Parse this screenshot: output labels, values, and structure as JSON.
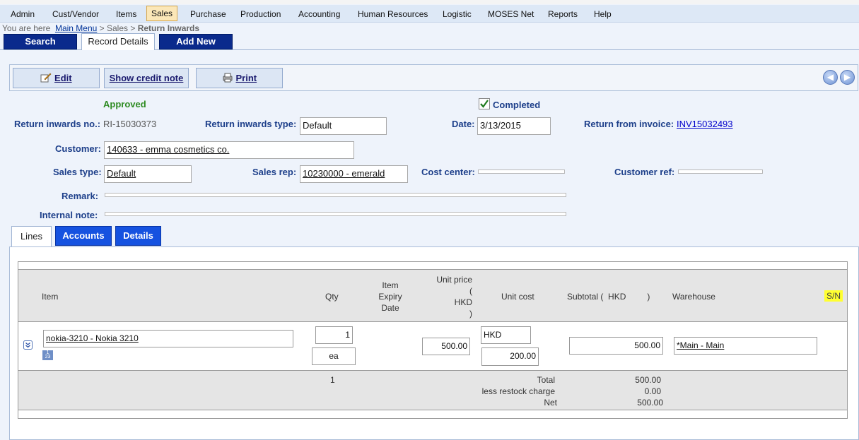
{
  "menu": [
    "Admin",
    "Cust/Vendor",
    "Items",
    "Sales",
    "Purchase",
    "Production",
    "Accounting",
    "Human Resources",
    "Logistic",
    "MOSES Net",
    "Reports",
    "Help"
  ],
  "breadcrumb": {
    "prefix": "You are here",
    "main_menu": "Main Menu",
    "sep1": " > Sales > ",
    "current": "Return Inwards"
  },
  "tabs": {
    "search": "Search",
    "record_details": "Record Details",
    "add_new": "Add New"
  },
  "toolbar": {
    "edit": "Edit",
    "show_credit_note": "Show credit note",
    "print": "Print"
  },
  "status": {
    "approved": "Approved",
    "completed": "Completed"
  },
  "form": {
    "return_no_label": "Return inwards no.:",
    "return_no_value": "RI-15030373",
    "return_type_label": "Return inwards type:",
    "return_type_value": "Default",
    "date_label": "Date:",
    "date_value": "3/13/2015",
    "return_from_invoice_label": "Return from invoice:",
    "return_from_invoice_value": "INV15032493",
    "customer_label": "Customer:",
    "customer_value": "140633 - emma cosmetics co.",
    "sales_type_label": "Sales type:",
    "sales_type_value": "Default",
    "sales_rep_label": "Sales rep:",
    "sales_rep_value": "10230000 - emerald",
    "cost_center_label": "Cost center:",
    "customer_ref_label": "Customer ref:",
    "remark_label": "Remark:",
    "internal_note_label": "Internal note:"
  },
  "line_tabs": {
    "lines": "Lines",
    "accounts": "Accounts",
    "details": "Details"
  },
  "grid": {
    "headers": {
      "item": "Item",
      "qty": "Qty",
      "expiry_1": "Item",
      "expiry_2": "Expiry",
      "expiry_3": "Date",
      "unit_price_1": "Unit price",
      "unit_price_2": "(",
      "unit_price_3": "HKD",
      "unit_price_4": ")",
      "unit_cost": "Unit cost",
      "subtotal": "Subtotal (  HKD         )",
      "warehouse": "Warehouse",
      "sn": "S/N"
    },
    "row": {
      "item": "nokia-3210 - Nokia 3210",
      "qty": "1",
      "unit": "ea",
      "unit_price": "500.00",
      "cost_currency": "HKD",
      "unit_cost": "200.00",
      "subtotal": "500.00",
      "warehouse": "*Main - Main",
      "mini_badge": "1\n23"
    },
    "footer": {
      "total_qty": "1",
      "total_label": "Total",
      "restock_label": "less restock charge",
      "net_label": "Net",
      "total_value": "500.00",
      "restock_value": "0.00",
      "net_value": "500.00"
    }
  }
}
